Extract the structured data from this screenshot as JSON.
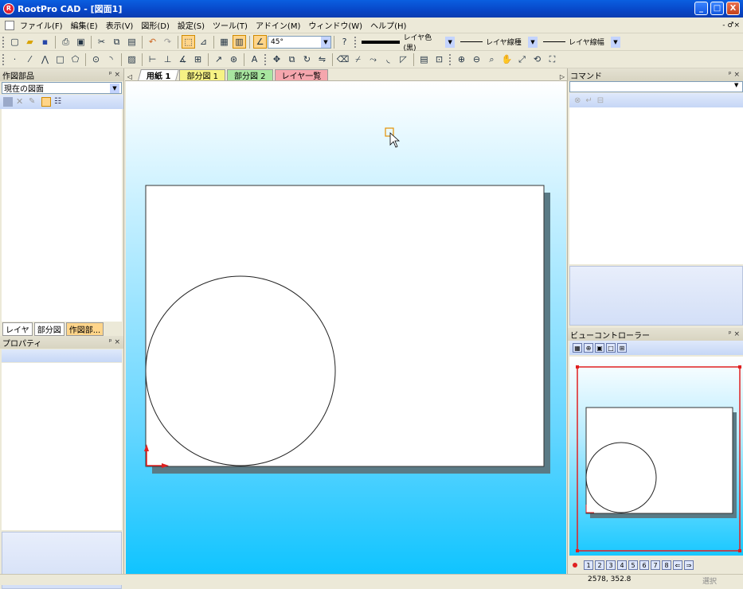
{
  "window": {
    "title": "RootPro CAD - [図面1]",
    "app_logo": "R",
    "minimize_label": "_",
    "maximize_label": "□",
    "close_label": "X",
    "mdi_min_label": "- ",
    "mdi_restore_label": "♂",
    "mdi_close_label": "×"
  },
  "menu": {
    "items": [
      "ファイル(F)",
      "編集(E)",
      "表示(V)",
      "図形(D)",
      "設定(S)",
      "ツール(T)",
      "アドイン(M)",
      "ウィンドウ(W)",
      "ヘルプ(H)"
    ]
  },
  "toolbar1": {
    "angle_value": "45°",
    "line_color_label": "レイヤ色 (黒)",
    "line_type_label": "レイヤ線種",
    "line_width_label": "レイヤ線幅"
  },
  "left_panel": {
    "parts_title": "作図部品",
    "drawing_select_value": "現在の図面",
    "bottom_tabs": [
      "レイヤ",
      "部分図",
      "作図部..."
    ],
    "properties_title": "プロパティ",
    "pin_close": "ᵖ ×"
  },
  "doc_tabs": {
    "prev": "◁",
    "next": "▷",
    "tabs": [
      {
        "label": "用紙 1",
        "color": "#ffffff",
        "active": true
      },
      {
        "label": "部分図 1",
        "color": "#f6f284",
        "active": false
      },
      {
        "label": "部分図 2",
        "color": "#a8e6a0",
        "active": false
      },
      {
        "label": "レイヤ一覧",
        "color": "#f5a6ad",
        "active": false
      }
    ]
  },
  "right_panel": {
    "command_title": "コマンド",
    "view_controller_title": "ビューコントローラー",
    "pin_close": "ᵖ ×",
    "view_numbers": [
      "1",
      "2",
      "3",
      "4",
      "5",
      "6",
      "7",
      "8"
    ]
  },
  "status": {
    "coords": "2578, 352.8",
    "mode": "選択"
  },
  "colors": {
    "accent_red": "#e02020",
    "paper_shadow": "#5a7a85",
    "title_blue": "#0a5fe0"
  }
}
